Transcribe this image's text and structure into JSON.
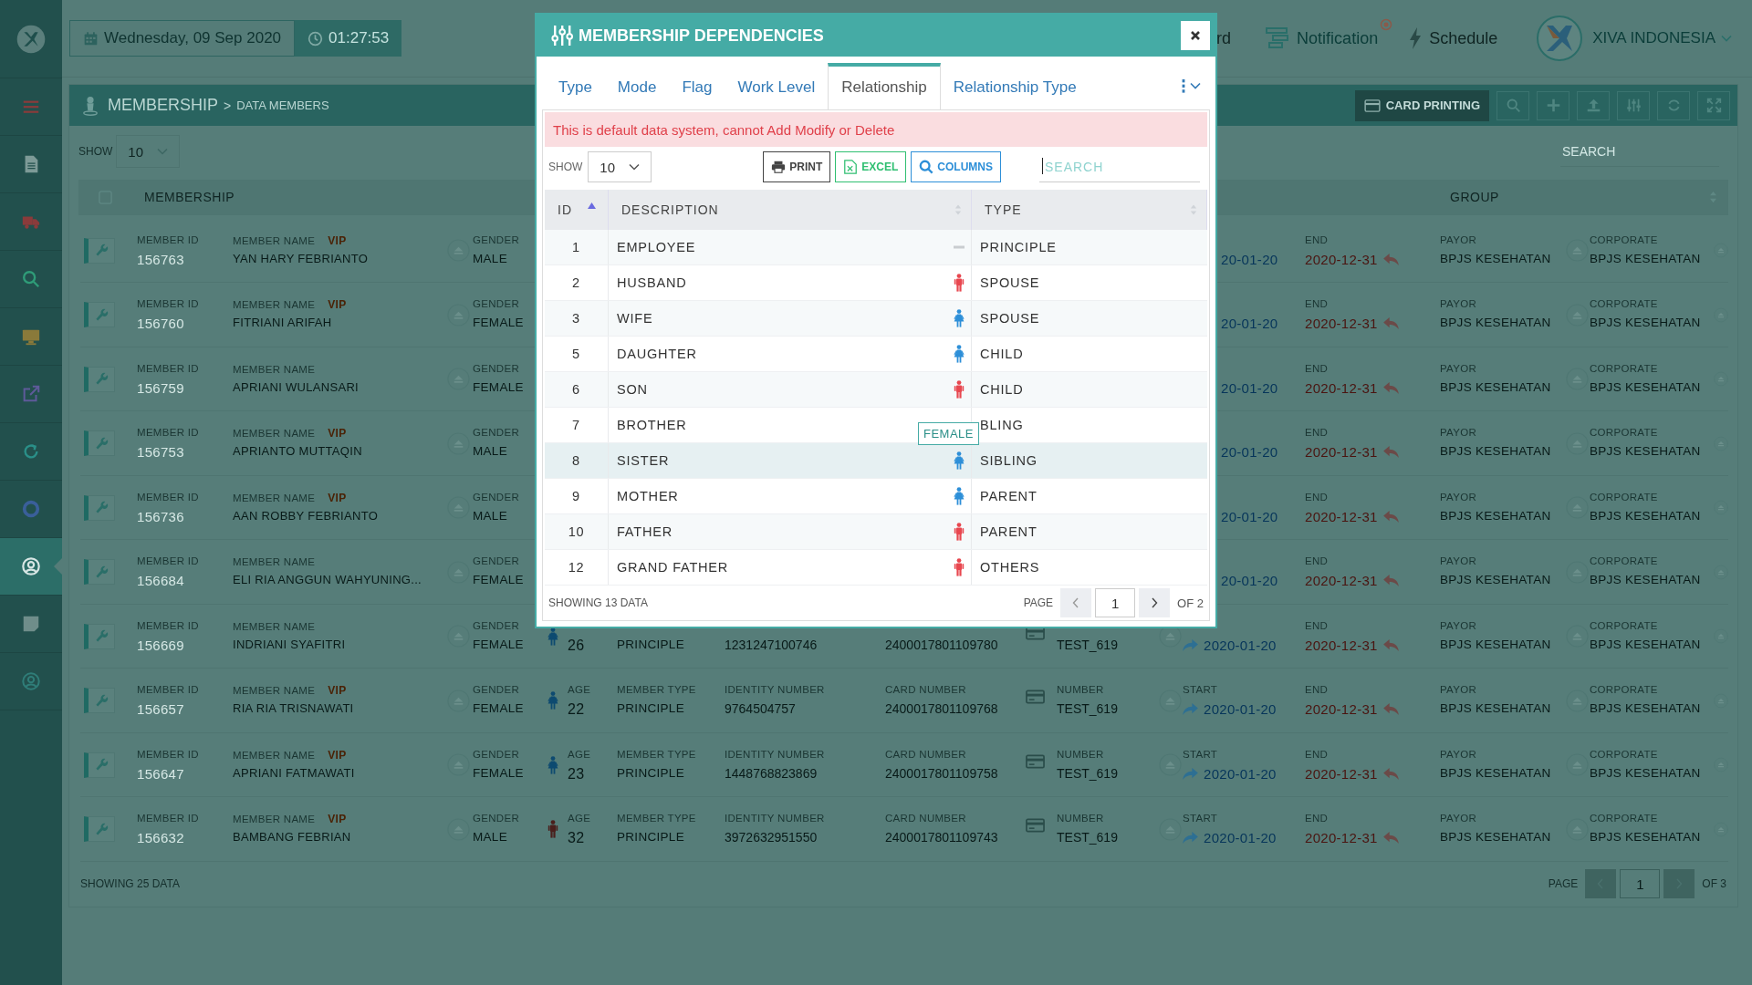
{
  "topbar": {
    "date": "Wednesday, 09 Sep 2020",
    "time": "01:27:53",
    "links": [
      {
        "label": "rd",
        "badge": false
      },
      {
        "label": "Notification",
        "badge": true
      },
      {
        "label": "Schedule",
        "badge": false
      }
    ],
    "company": "XIVA INDONESIA"
  },
  "sidebar": {
    "items": [
      {
        "selected": false
      },
      {
        "selected": false
      },
      {
        "selected": false
      },
      {
        "selected": false
      },
      {
        "selected": false
      },
      {
        "selected": false
      },
      {
        "selected": false
      },
      {
        "selected": false
      },
      {
        "selected": true
      },
      {
        "selected": false
      },
      {
        "selected": false
      }
    ]
  },
  "panel": {
    "title": "MEMBERSHIP",
    "separator": ">",
    "subtitle": "DATA MEMBERS",
    "card_button": "CARD PRINTING",
    "show": {
      "label": "SHOW",
      "value": "10"
    },
    "search": {
      "placeholder": "SEARCH"
    },
    "columns": [
      "MEMBERSHIP",
      "GROUP"
    ],
    "rows": [
      {
        "id": {
          "label": "MEMBER ID",
          "value": "156763"
        },
        "name": {
          "label": "MEMBER NAME",
          "value": "YAN HARY FEBRIANTO",
          "badge": "VIP"
        },
        "gender": {
          "label": "GENDER",
          "value": "MALE"
        },
        "start": {
          "value": "20-01-20",
          "arrow": false
        },
        "end": {
          "label": "END",
          "value": "2020-12-31"
        },
        "payor": {
          "label": "PAYOR",
          "value": "BPJS KESEHATAN"
        },
        "corporate": {
          "label": "CORPORATE",
          "value": "BPJS KESEHATAN"
        }
      },
      {
        "id": {
          "label": "MEMBER ID",
          "value": "156760"
        },
        "name": {
          "label": "MEMBER NAME",
          "value": "FITRIANI ARIFAH",
          "badge": "VIP"
        },
        "gender": {
          "label": "GENDER",
          "value": "FEMALE"
        },
        "start": {
          "value": "20-01-20",
          "arrow": false
        },
        "end": {
          "label": "END",
          "value": "2020-12-31"
        },
        "payor": {
          "label": "PAYOR",
          "value": "BPJS KESEHATAN"
        },
        "corporate": {
          "label": "CORPORATE",
          "value": "BPJS KESEHATAN"
        }
      },
      {
        "id": {
          "label": "MEMBER ID",
          "value": "156759"
        },
        "name": {
          "label": "MEMBER NAME",
          "value": "APRIANI WULANSARI"
        },
        "gender": {
          "label": "GENDER",
          "value": "FEMALE"
        },
        "start": {
          "value": "20-01-20",
          "arrow": false
        },
        "end": {
          "label": "END",
          "value": "2020-12-31"
        },
        "payor": {
          "label": "PAYOR",
          "value": "BPJS KESEHATAN"
        },
        "corporate": {
          "label": "CORPORATE",
          "value": "BPJS KESEHATAN"
        }
      },
      {
        "id": {
          "label": "MEMBER ID",
          "value": "156753"
        },
        "name": {
          "label": "MEMBER NAME",
          "value": "APRIANTO MUTTAQIN",
          "badge": "VIP"
        },
        "gender": {
          "label": "GENDER",
          "value": "MALE"
        },
        "start": {
          "value": "20-01-20",
          "arrow": false
        },
        "end": {
          "label": "END",
          "value": "2020-12-31"
        },
        "payor": {
          "label": "PAYOR",
          "value": "BPJS KESEHATAN"
        },
        "corporate": {
          "label": "CORPORATE",
          "value": "BPJS KESEHATAN"
        }
      },
      {
        "id": {
          "label": "MEMBER ID",
          "value": "156736"
        },
        "name": {
          "label": "MEMBER NAME",
          "value": "AAN ROBBY FEBRIANTO",
          "badge": "VIP"
        },
        "gender": {
          "label": "GENDER",
          "value": "MALE"
        },
        "start": {
          "value": "20-01-20",
          "arrow": false
        },
        "end": {
          "label": "END",
          "value": "2020-12-31"
        },
        "payor": {
          "label": "PAYOR",
          "value": "BPJS KESEHATAN"
        },
        "corporate": {
          "label": "CORPORATE",
          "value": "BPJS KESEHATAN"
        }
      },
      {
        "id": {
          "label": "MEMBER ID",
          "value": "156684"
        },
        "name": {
          "label": "MEMBER NAME",
          "value": "ELI RIA ANGGUN WAHYUNING..."
        },
        "gender": {
          "label": "GENDER",
          "value": "FEMALE"
        },
        "start": {
          "value": "20-01-20",
          "arrow": false
        },
        "end": {
          "label": "END",
          "value": "2020-12-31"
        },
        "payor": {
          "label": "PAYOR",
          "value": "BPJS KESEHATAN"
        },
        "corporate": {
          "label": "CORPORATE",
          "value": "BPJS KESEHATAN"
        }
      },
      {
        "id": {
          "label": "MEMBER ID",
          "value": "156669"
        },
        "name": {
          "label": "MEMBER NAME",
          "value": "INDRIANI SYAFITRI"
        },
        "gender": {
          "label": "GENDER",
          "value": "FEMALE"
        },
        "kind": "female",
        "age": {
          "value": "26"
        },
        "member_type": {
          "value": "PRINCIPLE"
        },
        "identity": {
          "value": "1231247100746"
        },
        "card": {
          "value": "2400017801109780"
        },
        "number": {
          "value": "TEST_619"
        },
        "start": {
          "value": "2020-01-20",
          "arrow": true
        },
        "end": {
          "label": "END",
          "value": "2020-12-31"
        },
        "payor": {
          "label": "PAYOR",
          "value": "BPJS KESEHATAN"
        },
        "corporate": {
          "label": "CORPORATE",
          "value": "BPJS KESEHATAN"
        }
      },
      {
        "id": {
          "label": "MEMBER ID",
          "value": "156657"
        },
        "name": {
          "label": "MEMBER NAME",
          "value": "RIA RIA TRISNAWATI",
          "badge": "VIP"
        },
        "gender": {
          "label": "GENDER",
          "value": "FEMALE"
        },
        "kind": "female",
        "age": {
          "label": "AGE",
          "value": "22"
        },
        "member_type": {
          "label": "MEMBER TYPE",
          "value": "PRINCIPLE"
        },
        "identity": {
          "label": "IDENTITY NUMBER",
          "value": "9764504757"
        },
        "card": {
          "label": "CARD NUMBER",
          "value": "2400017801109768"
        },
        "number": {
          "label": "NUMBER",
          "value": "TEST_619"
        },
        "start": {
          "label": "START",
          "value": "2020-01-20",
          "arrow": true
        },
        "end": {
          "label": "END",
          "value": "2020-12-31"
        },
        "payor": {
          "label": "PAYOR",
          "value": "BPJS KESEHATAN"
        },
        "corporate": {
          "label": "CORPORATE",
          "value": "BPJS KESEHATAN"
        }
      },
      {
        "id": {
          "label": "MEMBER ID",
          "value": "156647"
        },
        "name": {
          "label": "MEMBER NAME",
          "value": "APRIANI FATMAWATI",
          "badge": "VIP"
        },
        "gender": {
          "label": "GENDER",
          "value": "FEMALE"
        },
        "kind": "female",
        "age": {
          "label": "AGE",
          "value": "23"
        },
        "member_type": {
          "label": "MEMBER TYPE",
          "value": "PRINCIPLE"
        },
        "identity": {
          "label": "IDENTITY NUMBER",
          "value": "1448768823869"
        },
        "card": {
          "label": "CARD NUMBER",
          "value": "2400017801109758"
        },
        "number": {
          "label": "NUMBER",
          "value": "TEST_619"
        },
        "start": {
          "label": "START",
          "value": "2020-01-20",
          "arrow": true
        },
        "end": {
          "label": "END",
          "value": "2020-12-31"
        },
        "payor": {
          "label": "PAYOR",
          "value": "BPJS KESEHATAN"
        },
        "corporate": {
          "label": "CORPORATE",
          "value": "BPJS KESEHATAN"
        }
      },
      {
        "id": {
          "label": "MEMBER ID",
          "value": "156632"
        },
        "name": {
          "label": "MEMBER NAME",
          "value": "BAMBANG FEBRIAN",
          "badge": "VIP"
        },
        "gender": {
          "label": "GENDER",
          "value": "MALE"
        },
        "kind": "male",
        "age": {
          "label": "AGE",
          "value": "32"
        },
        "member_type": {
          "label": "MEMBER TYPE",
          "value": "PRINCIPLE"
        },
        "identity": {
          "label": "IDENTITY NUMBER",
          "value": "3972632951550"
        },
        "card": {
          "label": "CARD NUMBER",
          "value": "2400017801109743"
        },
        "number": {
          "label": "NUMBER",
          "value": "TEST_619"
        },
        "start": {
          "label": "START",
          "value": "2020-01-20",
          "arrow": true
        },
        "end": {
          "label": "END",
          "value": "2020-12-31"
        },
        "payor": {
          "label": "PAYOR",
          "value": "BPJS KESEHATAN"
        },
        "corporate": {
          "label": "CORPORATE",
          "value": "BPJS KESEHATAN"
        }
      }
    ],
    "footer": "SHOWING 25 DATA",
    "pager": {
      "label": "PAGE",
      "page": "1",
      "of": "OF 3"
    }
  },
  "modal": {
    "title": "MEMBERSHIP DEPENDENCIES",
    "tabs": [
      {
        "label": "Type",
        "selected": false
      },
      {
        "label": "Mode",
        "selected": false
      },
      {
        "label": "Flag",
        "selected": false
      },
      {
        "label": "Work Level",
        "selected": false
      },
      {
        "label": "Relationship",
        "selected": true
      },
      {
        "label": "Relationship Type",
        "selected": false
      }
    ],
    "alert": "This is default data system, cannot Add Modify or Delete",
    "show": {
      "label": "SHOW",
      "value": "10"
    },
    "buttons": [
      {
        "label": "PRINT",
        "kind": "print"
      },
      {
        "label": "EXCEL",
        "kind": "excel"
      },
      {
        "label": "COLUMNS",
        "kind": "columns"
      }
    ],
    "search": {
      "placeholder": "SEARCH",
      "focused": true
    },
    "columns": [
      {
        "label": "ID",
        "sorted": true
      },
      {
        "label": "DESCRIPTION",
        "sorted": false
      },
      {
        "label": "TYPE",
        "sorted": false
      }
    ],
    "rows": [
      {
        "id": "1",
        "description": "EMPLOYEE",
        "kind": "none",
        "type": "PRINCIPLE",
        "hovered": false
      },
      {
        "id": "2",
        "description": "HUSBAND",
        "kind": "male",
        "type": "SPOUSE",
        "hovered": false
      },
      {
        "id": "3",
        "description": "WIFE",
        "kind": "female",
        "type": "SPOUSE",
        "hovered": false
      },
      {
        "id": "5",
        "description": "DAUGHTER",
        "kind": "female",
        "type": "CHILD",
        "hovered": false
      },
      {
        "id": "6",
        "description": "SON",
        "kind": "male",
        "type": "CHILD",
        "hovered": false
      },
      {
        "id": "7",
        "description": "BROTHER",
        "type": "BLING",
        "hovered": false
      },
      {
        "id": "8",
        "description": "SISTER",
        "kind": "female",
        "type": "SIBLING",
        "hovered": true,
        "tooltip": "FEMALE"
      },
      {
        "id": "9",
        "description": "MOTHER",
        "kind": "female",
        "type": "PARENT",
        "hovered": false
      },
      {
        "id": "10",
        "description": "FATHER",
        "kind": "male",
        "type": "PARENT",
        "hovered": false
      },
      {
        "id": "12",
        "description": "GRAND FATHER",
        "kind": "male",
        "type": "OTHERS",
        "hovered": false
      }
    ],
    "footer": "SHOWING 13 DATA",
    "pager": {
      "label": "PAGE",
      "page": "1",
      "of": "OF 2"
    }
  }
}
